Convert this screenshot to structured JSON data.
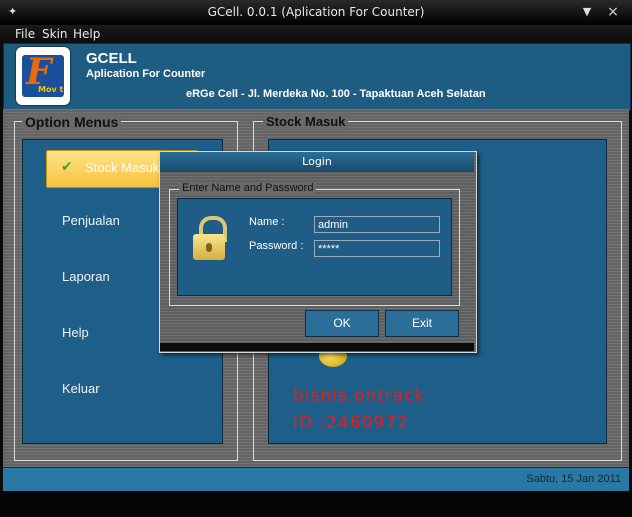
{
  "window": {
    "title": "GCell. 0.0.1 (Aplication For Counter)",
    "icon": "✦",
    "minimize": "▼",
    "close": "×"
  },
  "menubar": [
    {
      "label": "File"
    },
    {
      "label": "Skin"
    },
    {
      "label": "Help"
    }
  ],
  "header": {
    "logo_letter": "F",
    "logo_caption": "Mov t",
    "title": "GCELL",
    "subtitle": "Aplication For Counter",
    "address": "eRGe Cell - Jl. Merdeka No. 100 - Tapaktuan Aceh Selatan"
  },
  "option_menus": {
    "label": "Option Menus",
    "selected": "Stock Masuk",
    "items": [
      "Penjualan",
      "Laporan",
      "Help",
      "Keluar"
    ]
  },
  "stock_masuk": {
    "label": "Stock Masuk"
  },
  "watermark": {
    "line1": "bisnis.ontrack",
    "line2": "ID :2460972"
  },
  "status": {
    "date": "Sabtu, 15 Jan 2011"
  },
  "login": {
    "title": "Login",
    "group_label": "Enter Name and Password",
    "name_label": "Name :",
    "name_value": "admin",
    "password_label": "Password :",
    "password_value": "*****",
    "ok": "OK",
    "exit": "Exit"
  },
  "colors": {
    "accent": "#1f5c82",
    "selected_menu": "#f7c23d",
    "watermark": "#e81c1c"
  }
}
